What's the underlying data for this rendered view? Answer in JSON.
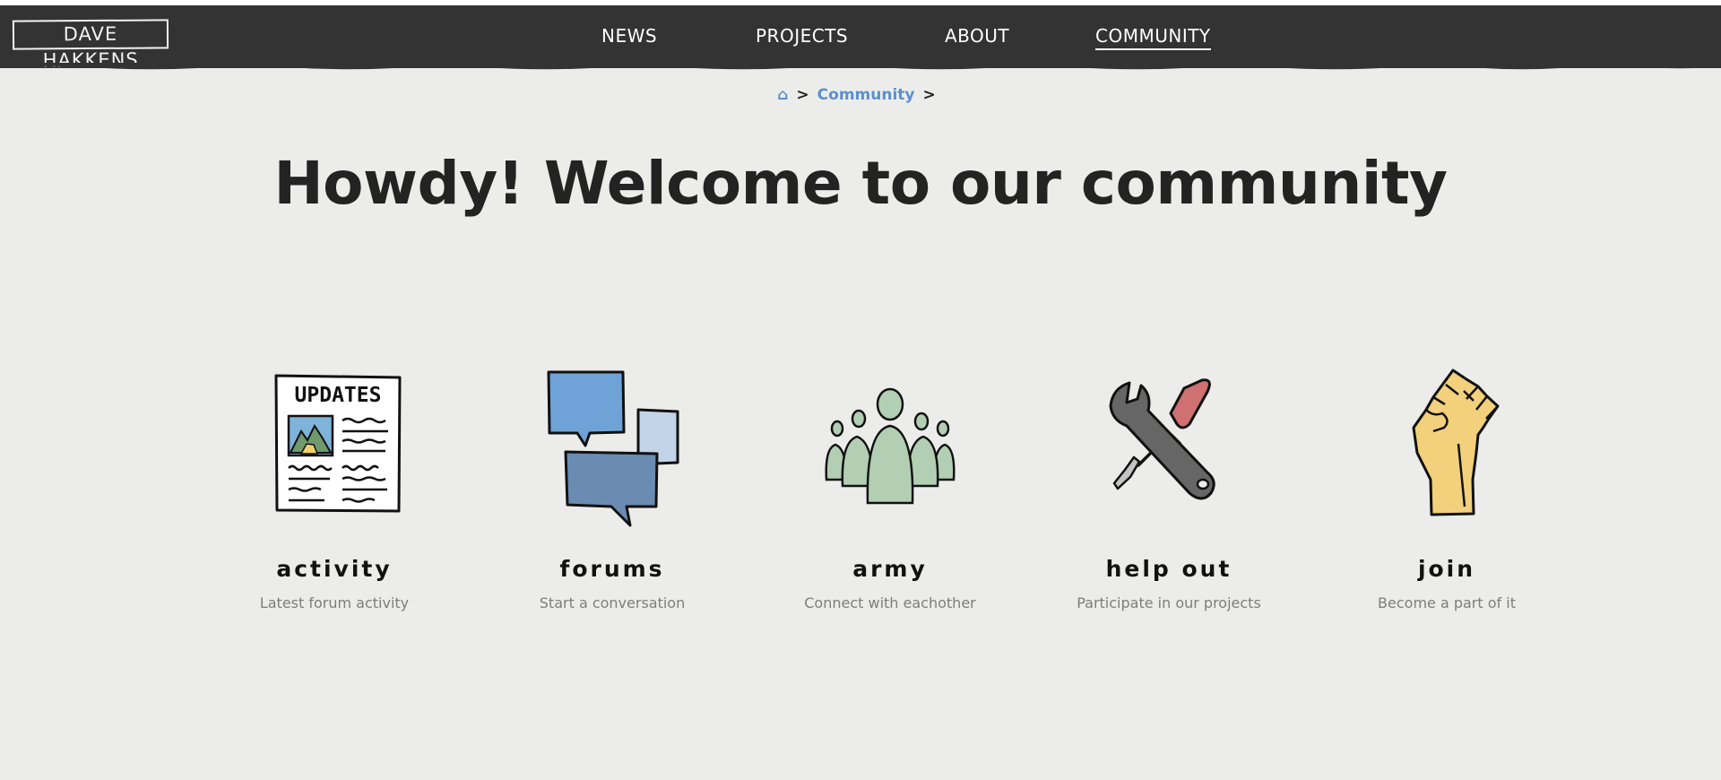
{
  "colors": {
    "nav_background": "#333333",
    "page_background": "#ecedeb",
    "link_blue": "#5b8fcf",
    "heading": "#232323",
    "muted": "#7d7d7d"
  },
  "header": {
    "logo_text": "DAVE HAKKENS",
    "nav": [
      {
        "label": "NEWS",
        "active": false
      },
      {
        "label": "PROJECTS",
        "active": false
      },
      {
        "label": "ABOUT",
        "active": false
      },
      {
        "label": "COMMUNITY",
        "active": true
      }
    ]
  },
  "breadcrumb": {
    "home_icon": "⌂",
    "separator": ">",
    "items": [
      "Community"
    ]
  },
  "main": {
    "title": "Howdy! Welcome to our community",
    "sections": [
      {
        "label": "activity",
        "description": "Latest forum activity",
        "icon": "newspaper-updates-icon",
        "icon_text": "UPDATES"
      },
      {
        "label": "forums",
        "description": "Start a conversation",
        "icon": "speech-bubbles-icon"
      },
      {
        "label": "army",
        "description": "Connect with eachother",
        "icon": "people-group-icon"
      },
      {
        "label": "help out",
        "description": "Participate in our projects",
        "icon": "wrench-screwdriver-icon"
      },
      {
        "label": "join",
        "description": "Become a part of it",
        "icon": "raised-fist-icon"
      }
    ]
  }
}
